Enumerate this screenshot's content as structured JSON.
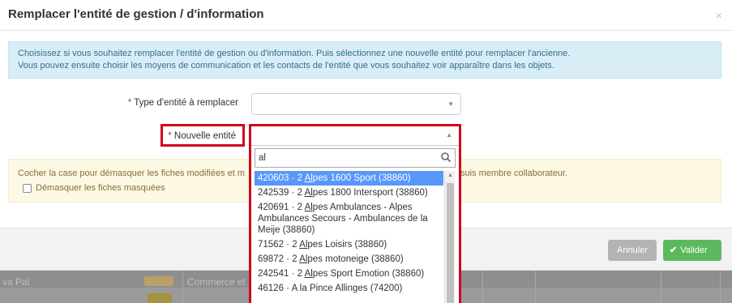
{
  "modal": {
    "title": "Remplacer l'entité de gestion / d'information",
    "close": "×"
  },
  "info": {
    "line1": "Choisissez si vous souhaitez remplacer l'entité de gestion ou d'information. Puis sélectionnez une nouvelle entité pour remplacer l'ancienne.",
    "line2": "Vous pouvez ensuite choisir les moyens de communication et les contacts de l'entité que vous souhaitez voir apparaître dans les objets."
  },
  "form": {
    "required_mark": "*",
    "type_label": "Type d'entité à remplacer",
    "type_value": "",
    "new_entity_label": "Nouvelle entité",
    "new_entity_value": ""
  },
  "warning": {
    "text_left": "Cocher la case pour démasquer les fiches modifiées et m",
    "text_right": "suis membre collaborateur.",
    "checkbox_label": "Démasquer les fiches masquées",
    "checkbox_checked": false
  },
  "dropdown": {
    "search_value": "al",
    "items": [
      {
        "id": "420603",
        "pre": "420603 · 2 ",
        "match": "Al",
        "post": "pes 1600 Sport (38860)",
        "active": true
      },
      {
        "id": "242539",
        "pre": "242539 · 2 ",
        "match": "Al",
        "post": "pes 1800 Intersport (38860)",
        "active": false
      },
      {
        "id": "420691",
        "pre": "420691 · 2 ",
        "match": "Al",
        "post": "pes Ambulances - Alpes Ambulances Secours - Ambulances de la Meije (38860)",
        "active": false
      },
      {
        "id": "71562",
        "pre": "71562 · 2 ",
        "match": "Al",
        "post": "pes Loisirs (38860)",
        "active": false
      },
      {
        "id": "69872",
        "pre": "69872 · 2 ",
        "match": "Al",
        "post": "pes motoneige (38860)",
        "active": false
      },
      {
        "id": "242541",
        "pre": "242541 · 2 ",
        "match": "Al",
        "post": "pes Sport Emotion (38860)",
        "active": false
      },
      {
        "id": "46126",
        "pre": "46126 · A la Pince Allinges (74200)",
        "match": "",
        "post": "",
        "active": false
      }
    ]
  },
  "buttons": {
    "cancel": "Annuler",
    "ok": "Valider",
    "ok_icon": "✔"
  },
  "background": {
    "cell1": "va Pal",
    "cell2": "Commerce et s"
  },
  "colors": {
    "info_bg": "#d9edf7",
    "warning_bg": "#fcf8e3",
    "highlight_red": "#d0021b",
    "select_active": "#5897fb",
    "ok_green": "#5cb85c"
  }
}
